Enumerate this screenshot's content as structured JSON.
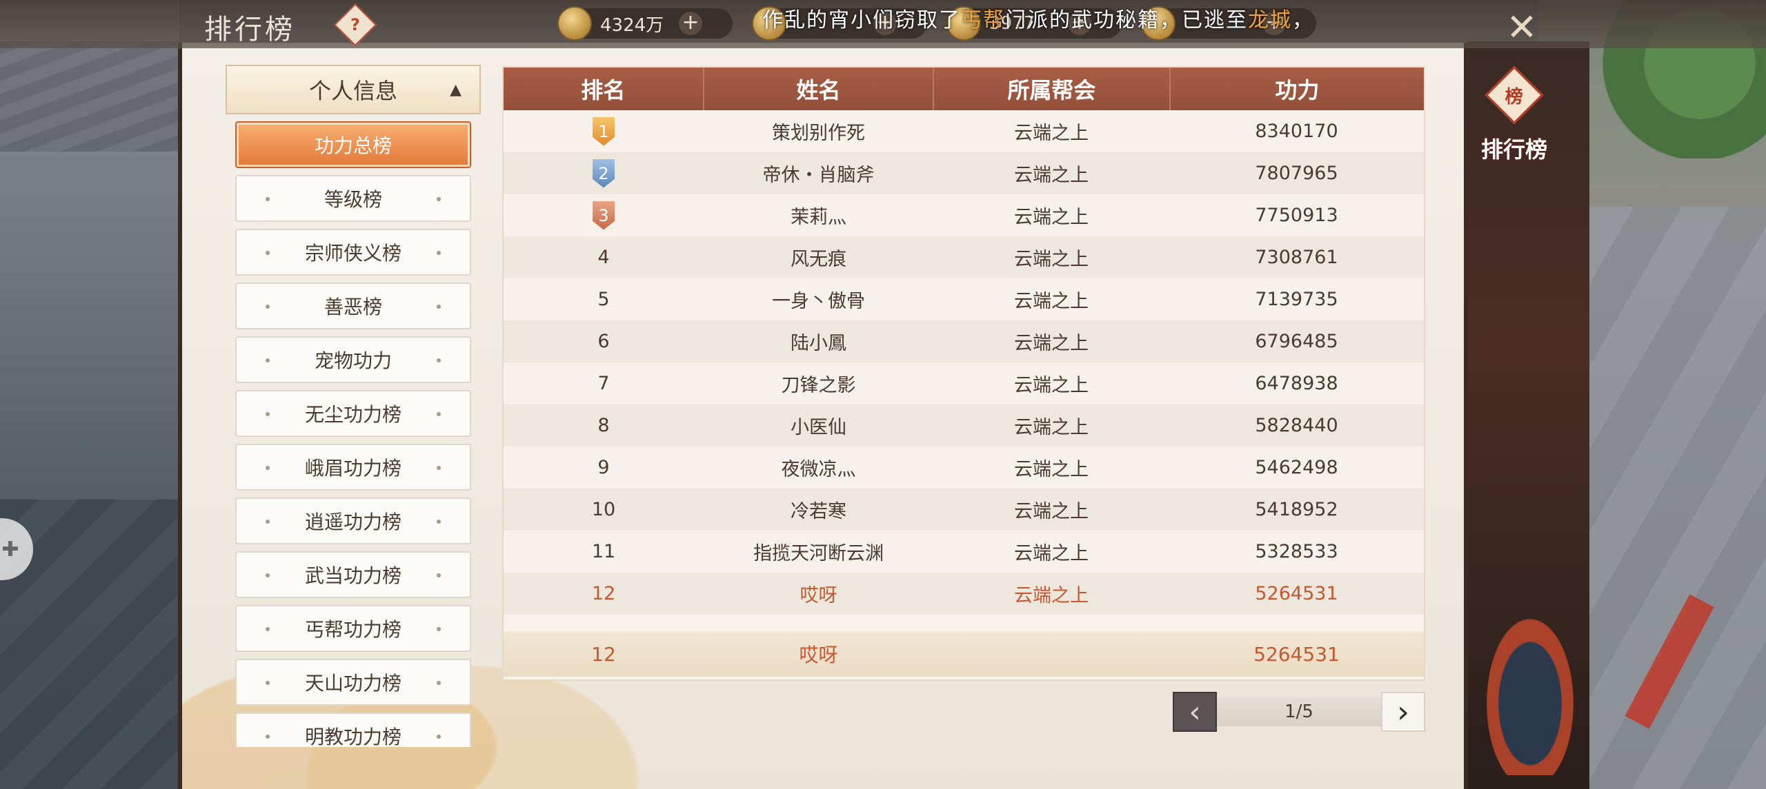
{
  "header": {
    "title": "排行榜",
    "help_symbol": "?",
    "currencies": [
      {
        "value": "4324万"
      },
      {
        "value": ""
      },
      {
        "value": "3977"
      },
      {
        "value": ""
      }
    ],
    "plus_symbol": "+",
    "marquee": {
      "part1": "作乱的宵小们窃取了",
      "highlight1": "丐帮",
      "part2": "门派的武功秘籍，已逃至",
      "highlight2": "龙城",
      "part3": "，请各位大侠"
    },
    "close_symbol": "✕"
  },
  "sidebar": {
    "header": "个人信息",
    "header_arrow": "▲",
    "items": [
      {
        "label": "功力总榜"
      },
      {
        "label": "等级榜"
      },
      {
        "label": "宗师侠义榜"
      },
      {
        "label": "善恶榜"
      },
      {
        "label": "宠物功力"
      },
      {
        "label": "无尘功力榜"
      },
      {
        "label": "峨眉功力榜"
      },
      {
        "label": "逍遥功力榜"
      },
      {
        "label": "武当功力榜"
      },
      {
        "label": "丐帮功力榜"
      },
      {
        "label": "天山功力榜"
      },
      {
        "label": "明教功力榜"
      }
    ]
  },
  "table": {
    "columns": [
      "排名",
      "姓名",
      "所属帮会",
      "功力"
    ],
    "rows": [
      {
        "rank": "1",
        "name": "策划别作死",
        "guild": "云端之上",
        "power": "8340170"
      },
      {
        "rank": "2",
        "name": "帝休・肖脑斧",
        "guild": "云端之上",
        "power": "7807965"
      },
      {
        "rank": "3",
        "name": "茉莉灬",
        "guild": "云端之上",
        "power": "7750913"
      },
      {
        "rank": "4",
        "name": "风无痕",
        "guild": "云端之上",
        "power": "7308761"
      },
      {
        "rank": "5",
        "name": "一身丶傲骨",
        "guild": "云端之上",
        "power": "7139735"
      },
      {
        "rank": "6",
        "name": "陆小鳳",
        "guild": "云端之上",
        "power": "6796485"
      },
      {
        "rank": "7",
        "name": "刀锋之影",
        "guild": "云端之上",
        "power": "6478938"
      },
      {
        "rank": "8",
        "name": "小医仙",
        "guild": "云端之上",
        "power": "5828440"
      },
      {
        "rank": "9",
        "name": "夜微凉灬",
        "guild": "云端之上",
        "power": "5462498"
      },
      {
        "rank": "10",
        "name": "冷若寒",
        "guild": "云端之上",
        "power": "5418952"
      },
      {
        "rank": "11",
        "name": "指揽天河断云渊",
        "guild": "云端之上",
        "power": "5328533"
      },
      {
        "rank": "12",
        "name": "哎呀",
        "guild": "云端之上",
        "power": "5264531"
      }
    ],
    "my_row": {
      "rank": "12",
      "name": "哎呀",
      "guild": "",
      "power": "5264531"
    }
  },
  "pager": {
    "prev_symbol": "‹",
    "next_symbol": "›",
    "page_text": "1/5"
  },
  "side_tab": {
    "seal": "榜",
    "label": "排行榜"
  },
  "colors": {
    "accent_orange": "#e2783a",
    "header_brown": "#a85d45",
    "self_highlight": "#c6572e"
  }
}
